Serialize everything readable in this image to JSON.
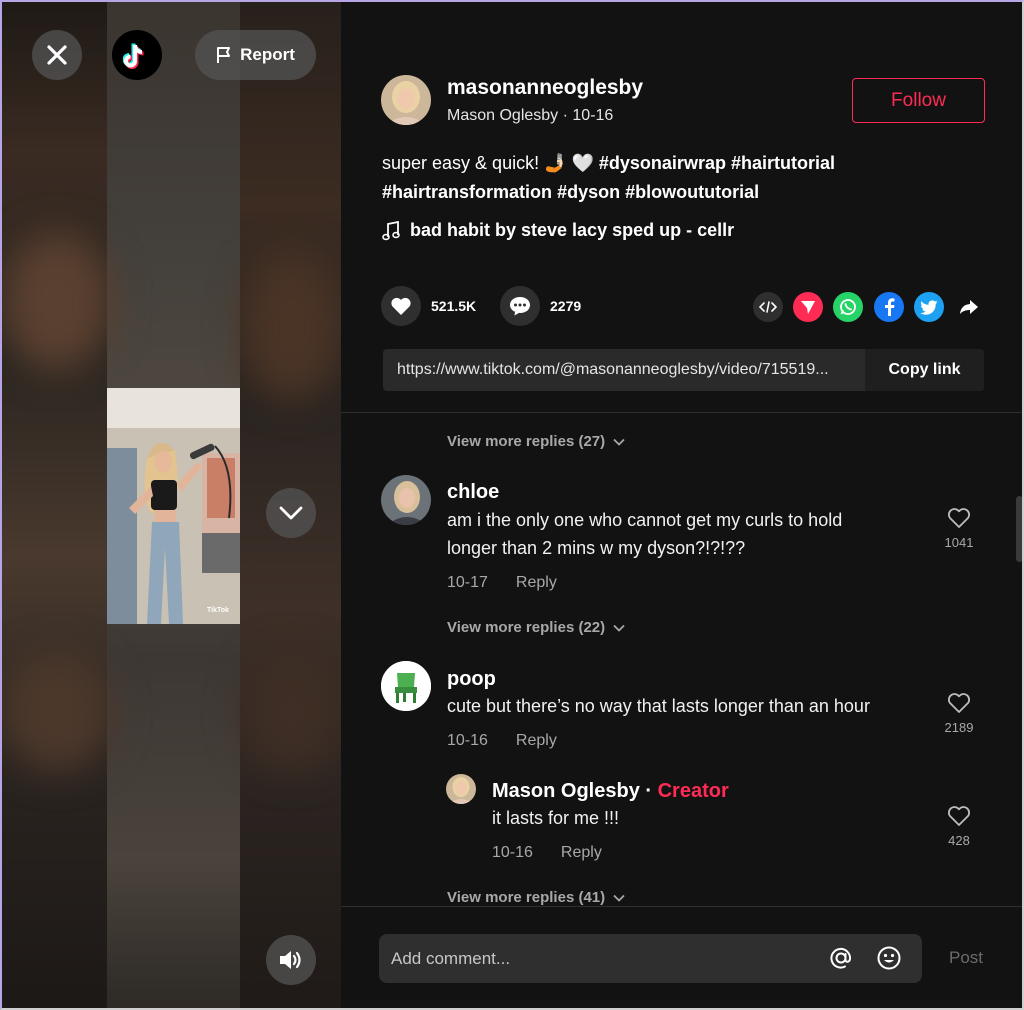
{
  "header": {
    "report_label": "Report"
  },
  "post": {
    "username": "masonanneoglesby",
    "display_name": "Mason Oglesby",
    "date": "10-16",
    "follow_label": "Follow",
    "description_plain": "super easy & quick! 🤳🏻 🤍 ",
    "hashtags": [
      "#dysonairwrap",
      "#hairtutorial",
      "#hairtransformation",
      "#dyson",
      "#blowoututorial"
    ],
    "music": "bad habit by steve lacy sped up - cellr",
    "likes": "521.5K",
    "comments": "2279",
    "link": "https://www.tiktok.com/@masonanneoglesby/video/715519...",
    "copy_label": "Copy link"
  },
  "comments": [
    {
      "more_replies": "View more replies (27)"
    },
    {
      "name": "chloe",
      "text_line1": "am i the only one who cannot get my curls to hold",
      "text_line2": "longer than 2 mins w my dyson?!?!??",
      "date": "10-17",
      "reply_label": "Reply",
      "likes": "1041",
      "more_replies": "View more replies (22)"
    },
    {
      "name": "poop",
      "text": "cute but there’s no way that lasts longer than an hour",
      "date": "10-16",
      "reply_label": "Reply",
      "likes": "2189"
    },
    {
      "name": "Mason Oglesby",
      "separator": " · ",
      "badge": "Creator",
      "text": "it lasts for me !!!",
      "date": "10-16",
      "reply_label": "Reply",
      "likes": "428",
      "more_replies": "View more replies (41)"
    }
  ],
  "composer": {
    "placeholder": "Add comment...",
    "post_label": "Post"
  },
  "colors": {
    "accent": "#fe2c55",
    "panel_bg": "#121212",
    "tiktok_cyan": "#25f4ee"
  },
  "icons": [
    "close-icon",
    "tiktok-logo",
    "flag-icon",
    "chevron-down-icon",
    "volume-icon",
    "music-note-icon",
    "heart-icon",
    "comment-icon",
    "embed-icon",
    "send-icon",
    "whatsapp-icon",
    "facebook-icon",
    "twitter-icon",
    "share-arrow-icon",
    "at-mention-icon",
    "emoji-icon"
  ]
}
